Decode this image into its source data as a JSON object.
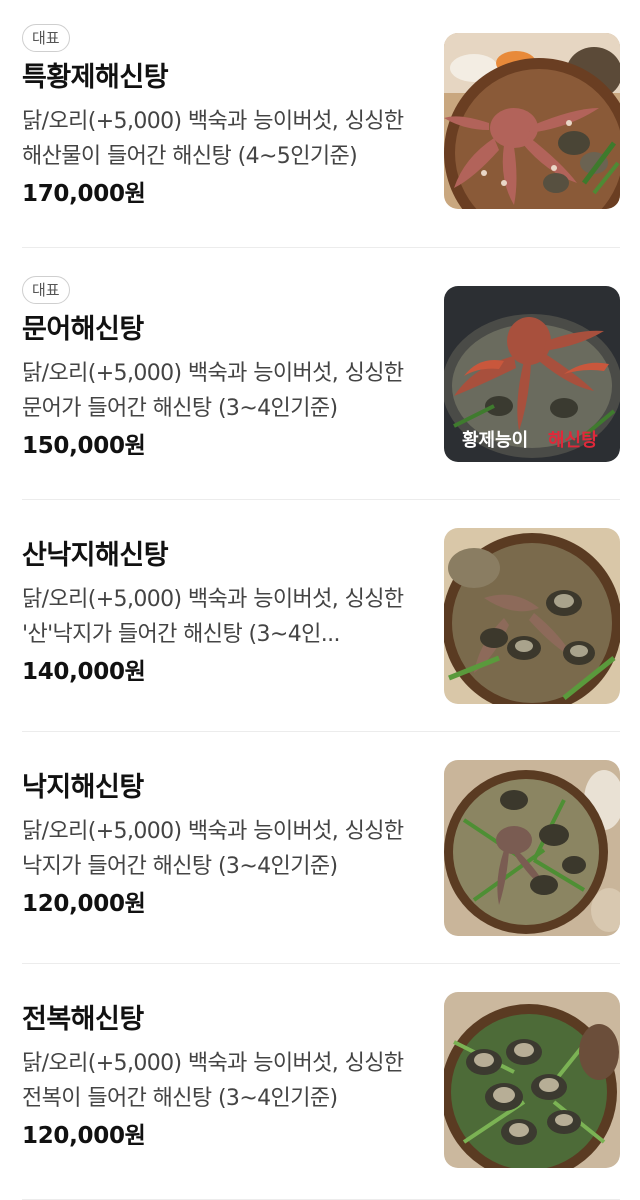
{
  "menu": [
    {
      "badge": "대표",
      "name": "특황제해신탕",
      "description": "닭/오리(+5,000) 백숙과 능이버섯, 싱싱한 해산물이 들어간 해신탕 (4~5인기준)",
      "price": "170,000원",
      "image_icon": "seafood-stew-photo"
    },
    {
      "badge": "대표",
      "name": "문어해신탕",
      "description": "닭/오리(+5,000) 백숙과 능이버섯, 싱싱한 문어가 들어간 해신탕 (3~4인기준)",
      "price": "150,000원",
      "image_icon": "octopus-stew-photo",
      "image_caption": "황제능이 해신탕"
    },
    {
      "name": "산낙지해신탕",
      "description": "닭/오리(+5,000) 백숙과 능이버섯, 싱싱한 '산'낙지가 들어간 해신탕 (3~4인...",
      "price": "140,000원",
      "image_icon": "live-octopus-stew-photo"
    },
    {
      "name": "낙지해신탕",
      "description": "닭/오리(+5,000) 백숙과 능이버섯, 싱싱한 낙지가 들어간 해신탕 (3~4인기준)",
      "price": "120,000원",
      "image_icon": "small-octopus-stew-photo"
    },
    {
      "name": "전복해신탕",
      "description": "닭/오리(+5,000) 백숙과 능이버섯, 싱싱한 전복이 들어간 해신탕 (3~4인기준)",
      "price": "120,000원",
      "image_icon": "abalone-stew-photo"
    }
  ]
}
